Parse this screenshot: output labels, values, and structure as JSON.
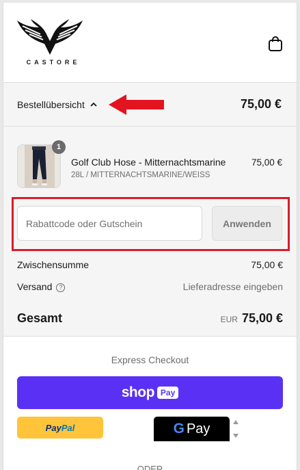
{
  "header": {
    "brand": "CASTORE"
  },
  "summary": {
    "toggle_label": "Bestellübersicht",
    "total": "75,00 €"
  },
  "product": {
    "quantity": "1",
    "name": "Golf Club Hose - Mitternachtsmarine",
    "variant": "28L / MITTERNACHTSMARINE/WEISS",
    "price": "75,00 €"
  },
  "discount": {
    "placeholder": "Rabattcode oder Gutschein",
    "apply_label": "Anwenden"
  },
  "totals": {
    "subtotal_label": "Zwischensumme",
    "subtotal_value": "75,00 €",
    "shipping_label": "Versand",
    "shipping_value": "Lieferadresse eingeben",
    "total_label": "Gesamt",
    "total_currency": "EUR",
    "total_value": "75,00 €"
  },
  "express": {
    "title": "Express Checkout",
    "shop_word": "shop",
    "shop_pay": "Pay",
    "paypal_pay": "Pay",
    "paypal_pal": "Pal",
    "gpay_g": "G",
    "gpay_pay": "Pay",
    "or_label": "ODER"
  },
  "colors": {
    "shop_pay": "#5a31f4",
    "paypal": "#ffc439",
    "highlight_red": "#d81d2a"
  }
}
